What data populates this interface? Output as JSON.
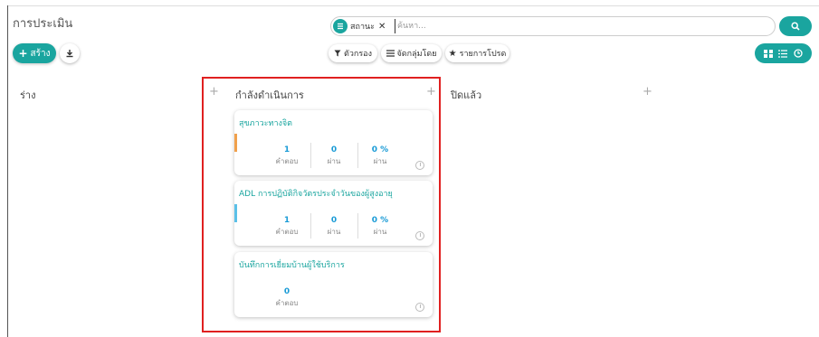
{
  "page": {
    "title": "การประเมิน"
  },
  "toolbar": {
    "create_label": "สร้าง"
  },
  "search": {
    "facet_label": "สถานะ",
    "placeholder": "ค้นหา..."
  },
  "filters": {
    "filter_label": "ตัวกรอง",
    "group_label": "จัดกลุ่มโดย",
    "favorites_label": "รายการโปรด"
  },
  "columns": [
    {
      "title": "ร่าง"
    },
    {
      "title": "กำลังดำเนินการ"
    },
    {
      "title": "ปิดแล้ว"
    }
  ],
  "cards": [
    {
      "title": "สุขภาวะทางจิต",
      "bar_color": "#f0a04b",
      "stats": [
        {
          "value": "1",
          "label": "คำตอบ"
        },
        {
          "value": "0",
          "label": "ผ่าน"
        },
        {
          "value": "0 %",
          "label": "ผ่าน"
        }
      ]
    },
    {
      "title": "ADL การปฏิบัติกิจวัตรประจำวันของผู้สูงอายุ",
      "bar_color": "#5bc0e8",
      "stats": [
        {
          "value": "1",
          "label": "คำตอบ"
        },
        {
          "value": "0",
          "label": "ผ่าน"
        },
        {
          "value": "0 %",
          "label": "ผ่าน"
        }
      ]
    },
    {
      "title": "บันทึกการเยี่ยมบ้านผู้ใช้บริการ",
      "bar_color": "",
      "stats": [
        {
          "value": "0",
          "label": "คำตอบ"
        }
      ]
    }
  ],
  "colors": {
    "accent": "#1aa59f",
    "stat_number": "#1a9bd6",
    "highlight_border": "#e02020"
  }
}
